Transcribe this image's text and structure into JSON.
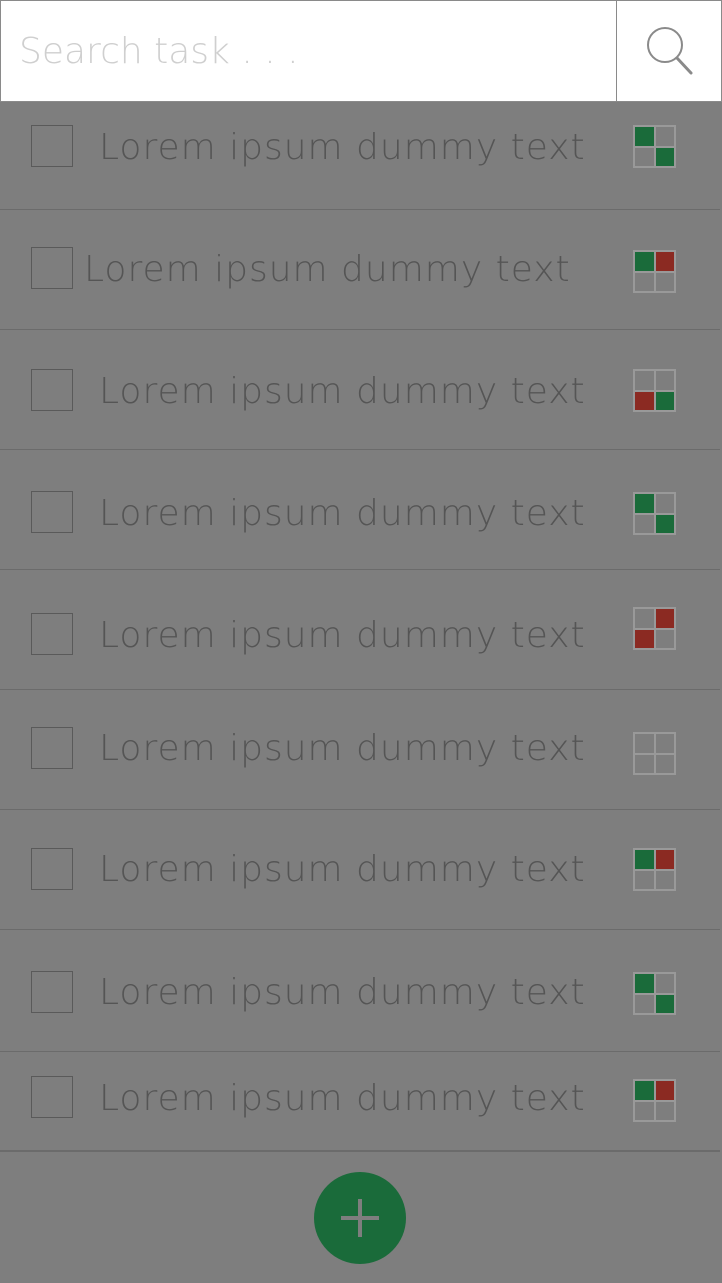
{
  "search": {
    "placeholder": "Search task . . ."
  },
  "tasks": [
    {
      "label": "Lorem ipsum dummy text",
      "priority": [
        "g",
        "",
        "",
        "g"
      ]
    },
    {
      "label": "Lorem ipsum dummy text",
      "priority": [
        "g",
        "r",
        "",
        ""
      ]
    },
    {
      "label": "Lorem ipsum dummy text",
      "priority": [
        "",
        "",
        "r",
        "g"
      ]
    },
    {
      "label": "Lorem ipsum dummy text",
      "priority": [
        "g",
        "",
        "",
        "g"
      ]
    },
    {
      "label": "Lorem ipsum dummy text",
      "priority": [
        "",
        "r",
        "r",
        ""
      ]
    },
    {
      "label": "Lorem ipsum dummy text",
      "priority": [
        "",
        "",
        "",
        ""
      ]
    },
    {
      "label": "Lorem ipsum dummy text",
      "priority": [
        "g",
        "r",
        "",
        ""
      ]
    },
    {
      "label": "Lorem ipsum dummy text",
      "priority": [
        "g",
        "",
        "",
        "g"
      ]
    },
    {
      "label": "Lorem ipsum dummy text",
      "priority": [
        "g",
        "r",
        "",
        ""
      ]
    }
  ],
  "colors": {
    "green": "#1a6b3a",
    "red": "#8b2a22",
    "background": "#7e7e7e"
  },
  "icons": {
    "search": "search-icon",
    "add": "plus-icon"
  }
}
